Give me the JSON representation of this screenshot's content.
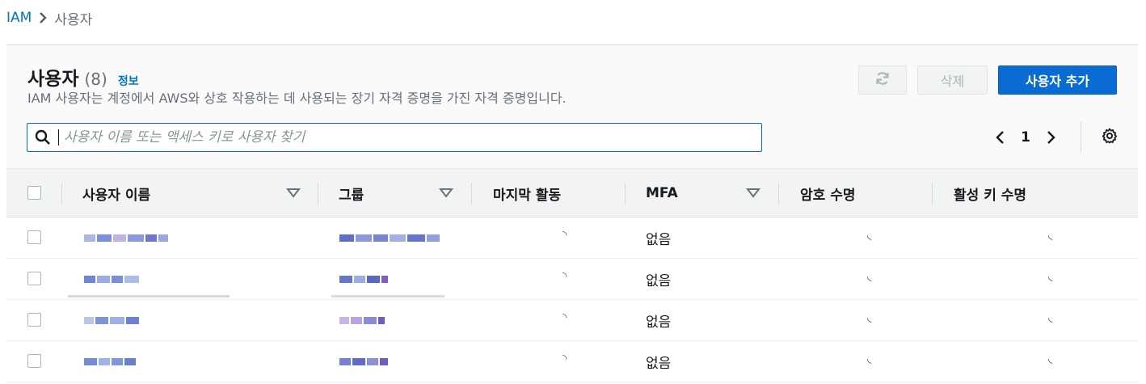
{
  "breadcrumb": {
    "root": "IAM",
    "current": "사용자"
  },
  "header": {
    "title": "사용자",
    "count": "(8)",
    "info": "정보",
    "description": "IAM 사용자는 계정에서 AWS와 상호 작용하는 데 사용되는 장기 자격 증명을 가진 자격 증명입니다."
  },
  "actions": {
    "refresh_icon": "refresh-icon",
    "delete_label": "삭제",
    "add_label": "사용자 추가"
  },
  "search": {
    "value": "",
    "placeholder": "사용자 이름 또는 액세스 키로 사용자 찾기"
  },
  "pagination": {
    "current_page": "1"
  },
  "table": {
    "columns": [
      "사용자 이름",
      "그룹",
      "마지막 활동",
      "MFA",
      "암호 수명",
      "활성 키 수명"
    ],
    "rows": [
      {
        "mfa": "없음"
      },
      {
        "mfa": "없음"
      },
      {
        "mfa": "없음"
      },
      {
        "mfa": "없음"
      }
    ]
  },
  "colors": {
    "link": "#0073bb",
    "primary": "#0a6cd3",
    "header_bg": "#f2f3f3"
  }
}
